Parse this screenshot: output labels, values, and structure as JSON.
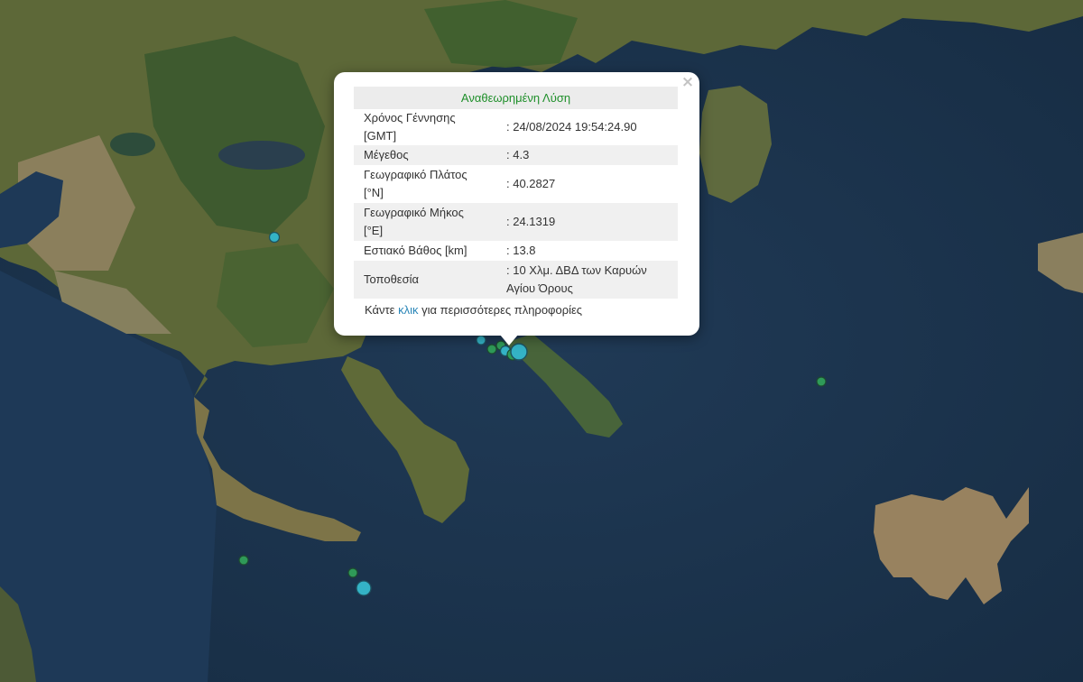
{
  "popup": {
    "title": "Αναθεωρημένη Λύση",
    "close_label": "×",
    "rows": [
      {
        "label": "Χρόνος Γέννησης [GMT]",
        "value": ": 24/08/2024 19:54:24.90"
      },
      {
        "label": "Μέγεθος",
        "value": ": 4.3"
      },
      {
        "label": "Γεωγραφικό Πλάτος [°N]",
        "value": ": 40.2827"
      },
      {
        "label": "Γεωγραφικό Μήκος [°E]",
        "value": ": 24.1319"
      },
      {
        "label": "Εστιακό Βάθος [km]",
        "value": ": 13.8"
      },
      {
        "label": "Τοποθεσία",
        "value": ": 10 Χλμ. ΔΒΔ των Καρυών Αγίου Όρους"
      }
    ],
    "footer": {
      "before": "Κάντε ",
      "link": "κλικ",
      "after": " για περισσότερες πληροφορίες"
    }
  },
  "colors": {
    "sea": "#1c3550",
    "land": "#5f6a3a",
    "forest": "#3f5a2e",
    "marker_cyan": "#34b3c6",
    "marker_green": "#2f9a58",
    "title_green": "#1f8f2a",
    "link": "#2a86b8"
  }
}
